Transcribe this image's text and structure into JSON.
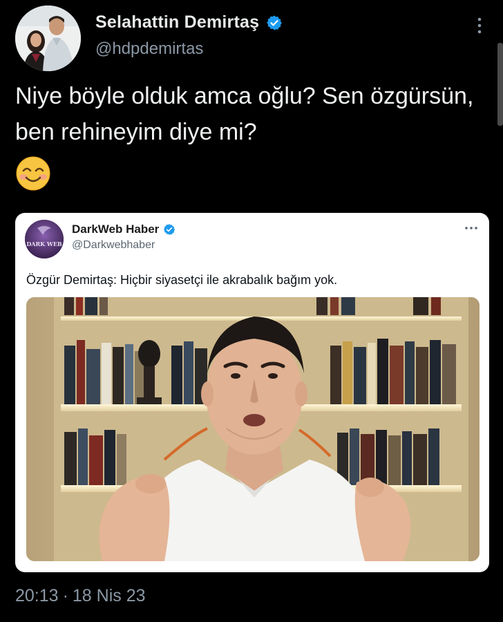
{
  "author": {
    "display_name": "Selahattin Demirtaş",
    "handle": "@hdpdemirtas",
    "verified_icon": "verified-badge-icon",
    "avatar": "profile-photo"
  },
  "tweet": {
    "text": "Niye böyle olduk amca oğlu? Sen özgürsün, ben rehineyim diye mi?",
    "emoji": "smiling-face-with-smiling-eyes-emoji"
  },
  "quoted": {
    "display_name": "DarkWeb Haber",
    "handle": "@Darkwebhaber",
    "text": "Özgür Demirtaş: Hiçbir siyasetçi ile akrabalık bağım yok.",
    "avatar_text": "DARK WEB",
    "media": "photo-man-speaking-in-front-of-bookshelf"
  },
  "timestamp": {
    "time": "20:13",
    "separator": "·",
    "date": "18 Nis 23"
  },
  "colors": {
    "background": "#000000",
    "primary_text": "#e7e9ea",
    "secondary_text": "#8b98a5",
    "verified_blue": "#1d9bf0",
    "card_background": "#ffffff"
  }
}
